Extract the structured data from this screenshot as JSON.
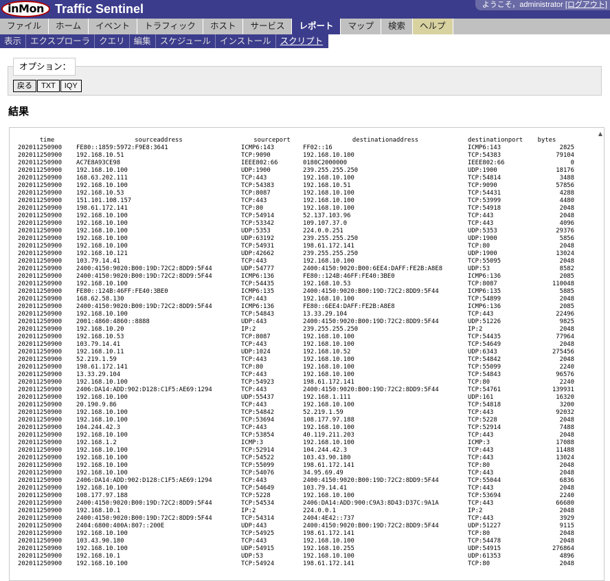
{
  "header": {
    "logo_text": "inMon",
    "app_title": "Traffic Sentinel",
    "welcome": "ようこそ，administrator ",
    "logout": "[ログアウト]"
  },
  "menu": [
    "ファイル",
    "ホーム",
    "イベント",
    "トラフィック",
    "ホスト",
    "サービス",
    "レポート",
    "マップ",
    "検索",
    "ヘルプ"
  ],
  "submenu": [
    "表示",
    "エクスプローラ",
    "クエリ",
    "編集",
    "スケジュール",
    "インストール",
    "スクリプト"
  ],
  "options": {
    "legend": "オプション：",
    "buttons": [
      "戻る",
      "TXT",
      "IQY"
    ]
  },
  "results": {
    "title": "結果",
    "columns": [
      "time",
      "sourceaddress",
      "sourceport",
      "destinationaddress",
      "destinationport",
      "bytes"
    ],
    "rows": [
      [
        "202011250900",
        "FE80::1859:5972:F9E8:3641",
        "ICMP6:143",
        "FF02::16",
        "ICMP6:143",
        "2825"
      ],
      [
        "202011250900",
        "192.168.10.51",
        "TCP:9090",
        "192.168.10.100",
        "TCP:54383",
        "79104"
      ],
      [
        "202011250900",
        "AC7E8A93CE98",
        "IEEE802:66",
        "0180C2000000",
        "IEEE802:66",
        "0"
      ],
      [
        "202011250900",
        "192.168.10.100",
        "UDP:1900",
        "239.255.255.250",
        "UDP:1900",
        "18176"
      ],
      [
        "202011250900",
        "168.63.202.111",
        "TCP:443",
        "192.168.10.100",
        "TCP:54814",
        "3488"
      ],
      [
        "202011250900",
        "192.168.10.100",
        "TCP:54383",
        "192.168.10.51",
        "TCP:9090",
        "57856"
      ],
      [
        "202011250900",
        "192.168.10.53",
        "TCP:8087",
        "192.168.10.100",
        "TCP:54431",
        "4288"
      ],
      [
        "202011250900",
        "151.101.108.157",
        "TCP:443",
        "192.168.10.100",
        "TCP:53999",
        "4480"
      ],
      [
        "202011250900",
        "198.61.172.141",
        "TCP:80",
        "192.168.10.100",
        "TCP:54918",
        "2048"
      ],
      [
        "202011250900",
        "192.168.10.100",
        "TCP:54914",
        "52.137.103.96",
        "TCP:443",
        "2048"
      ],
      [
        "202011250900",
        "192.168.10.100",
        "TCP:53342",
        "109.107.37.0",
        "TCP:443",
        "4096"
      ],
      [
        "202011250900",
        "192.168.10.100",
        "UDP:5353",
        "224.0.0.251",
        "UDP:5353",
        "29376"
      ],
      [
        "202011250900",
        "192.168.10.100",
        "UDP:63192",
        "239.255.255.250",
        "UDP:1900",
        "5856"
      ],
      [
        "202011250900",
        "192.168.10.100",
        "TCP:54931",
        "198.61.172.141",
        "TCP:80",
        "2048"
      ],
      [
        "202011250900",
        "192.168.10.121",
        "UDP:42662",
        "239.255.255.250",
        "UDP:1900",
        "13024"
      ],
      [
        "202011250900",
        "103.79.14.41",
        "TCP:443",
        "192.168.10.100",
        "TCP:55095",
        "2048"
      ],
      [
        "202011250900",
        "2400:4150:9020:B00:19D:72C2:8DD9:5F44",
        "UDP:54777",
        "2400:4150:9020:B00:6EE4:DAFF:FE2B:A8E8",
        "UDP:53",
        "8582"
      ],
      [
        "202011250900",
        "2400:4150:9020:B00:19D:72C2:8DD9:5F44",
        "ICMP6:136",
        "FE80::124B:46FF:FE40:3BE0",
        "ICMP6:136",
        "2085"
      ],
      [
        "202011250900",
        "192.168.10.100",
        "TCP:54435",
        "192.168.10.53",
        "TCP:8087",
        "110048"
      ],
      [
        "202011250900",
        "FE80::124B:46FF:FE40:3BE0",
        "ICMP6:135",
        "2400:4150:9020:B00:19D:72C2:8DD9:5F44",
        "ICMP6:135",
        "5885"
      ],
      [
        "202011250900",
        "168.62.58.130",
        "TCP:443",
        "192.168.10.100",
        "TCP:54899",
        "2048"
      ],
      [
        "202011250900",
        "2400:4150:9020:B00:19D:72C2:8DD9:5F44",
        "ICMP6:136",
        "FE80::6EE4:DAFF:FE2B:A8E8",
        "ICMP6:136",
        "2085"
      ],
      [
        "202011250900",
        "192.168.10.100",
        "TCP:54843",
        "13.33.29.104",
        "TCP:443",
        "22496"
      ],
      [
        "202011250900",
        "2001:4860:4860::8888",
        "UDP:443",
        "2400:4150:9020:B00:19D:72C2:8DD9:5F44",
        "UDP:51226",
        "9825"
      ],
      [
        "202011250900",
        "192.168.10.20",
        "IP:2",
        "239.255.255.250",
        "IP:2",
        "2048"
      ],
      [
        "202011250900",
        "192.168.10.53",
        "TCP:8087",
        "192.168.10.100",
        "TCP:54435",
        "77964"
      ],
      [
        "202011250900",
        "103.79.14.41",
        "TCP:443",
        "192.168.10.100",
        "TCP:54649",
        "2048"
      ],
      [
        "202011250900",
        "192.168.10.11",
        "UDP:1024",
        "192.168.10.52",
        "UDP:6343",
        "275456"
      ],
      [
        "202011250900",
        "52.219.1.59",
        "TCP:443",
        "192.168.10.100",
        "TCP:54842",
        "2048"
      ],
      [
        "202011250900",
        "198.61.172.141",
        "TCP:80",
        "192.168.10.100",
        "TCP:55099",
        "2240"
      ],
      [
        "202011250900",
        "13.33.29.104",
        "TCP:443",
        "192.168.10.100",
        "TCP:54843",
        "96576"
      ],
      [
        "202011250900",
        "192.168.10.100",
        "TCP:54923",
        "198.61.172.141",
        "TCP:80",
        "2240"
      ],
      [
        "202011250900",
        "2406:DA14:ADD:902:D128:C1F5:AE69:1294",
        "TCP:443",
        "2400:4150:9020:B00:19D:72C2:8DD9:5F44",
        "TCP:54761",
        "139931"
      ],
      [
        "202011250900",
        "192.168.10.100",
        "UDP:55437",
        "192.168.1.111",
        "UDP:161",
        "16320"
      ],
      [
        "202011250900",
        "20.190.9.86",
        "TCP:443",
        "192.168.10.100",
        "TCP:54818",
        "3200"
      ],
      [
        "202011250900",
        "192.168.10.100",
        "TCP:54842",
        "52.219.1.59",
        "TCP:443",
        "92032"
      ],
      [
        "202011250900",
        "192.168.10.100",
        "TCP:53694",
        "108.177.97.188",
        "TCP:5228",
        "2048"
      ],
      [
        "202011250900",
        "104.244.42.3",
        "TCP:443",
        "192.168.10.100",
        "TCP:52914",
        "7488"
      ],
      [
        "202011250900",
        "192.168.10.100",
        "TCP:53854",
        "40.119.211.203",
        "TCP:443",
        "2048"
      ],
      [
        "202011250900",
        "192.168.1.2",
        "ICMP:3",
        "192.168.10.100",
        "ICMP:3",
        "17088"
      ],
      [
        "202011250900",
        "192.168.10.100",
        "TCP:52914",
        "104.244.42.3",
        "TCP:443",
        "11488"
      ],
      [
        "202011250900",
        "192.168.10.100",
        "TCP:54522",
        "103.43.90.180",
        "TCP:443",
        "13024"
      ],
      [
        "202011250900",
        "192.168.10.100",
        "TCP:55099",
        "198.61.172.141",
        "TCP:80",
        "2048"
      ],
      [
        "202011250900",
        "192.168.10.100",
        "TCP:54076",
        "34.95.69.49",
        "TCP:443",
        "2048"
      ],
      [
        "202011250900",
        "2406:DA14:ADD:902:D128:C1F5:AE69:1294",
        "TCP:443",
        "2400:4150:9020:B00:19D:72C2:8DD9:5F44",
        "TCP:55044",
        "6836"
      ],
      [
        "202011250900",
        "192.168.10.100",
        "TCP:54649",
        "103.79.14.41",
        "TCP:443",
        "2048"
      ],
      [
        "202011250900",
        "108.177.97.188",
        "TCP:5228",
        "192.168.10.100",
        "TCP:53694",
        "2240"
      ],
      [
        "202011250900",
        "2400:4150:9020:B00:19D:72C2:8DD9:5F44",
        "TCP:54534",
        "2406:DA14:ADD:900:C9A3:8D43:D37C:9A1A",
        "TCP:443",
        "66680"
      ],
      [
        "202011250900",
        "192.168.10.1",
        "IP:2",
        "224.0.0.1",
        "IP:2",
        "2048"
      ],
      [
        "202011250900",
        "2400:4150:9020:B00:19D:72C2:8DD9:5F44",
        "TCP:54314",
        "2404:4E42::737",
        "TCP:443",
        "3929"
      ],
      [
        "202011250900",
        "2404:6800:400A:807::200E",
        "UDP:443",
        "2400:4150:9020:B00:19D:72C2:8DD9:5F44",
        "UDP:51227",
        "9115"
      ],
      [
        "202011250900",
        "192.168.10.100",
        "TCP:54925",
        "198.61.172.141",
        "TCP:80",
        "2048"
      ],
      [
        "202011250900",
        "103.43.90.180",
        "TCP:443",
        "192.168.10.100",
        "TCP:54478",
        "2048"
      ],
      [
        "202011250900",
        "192.168.10.100",
        "UDP:54915",
        "192.168.10.255",
        "UDP:54915",
        "276864"
      ],
      [
        "202011250900",
        "192.168.10.1",
        "UDP:53",
        "192.168.10.100",
        "UDP:61353",
        "4896"
      ],
      [
        "202011250900",
        "192.168.10.100",
        "TCP:54924",
        "198.61.172.141",
        "TCP:80",
        "2048"
      ]
    ]
  }
}
